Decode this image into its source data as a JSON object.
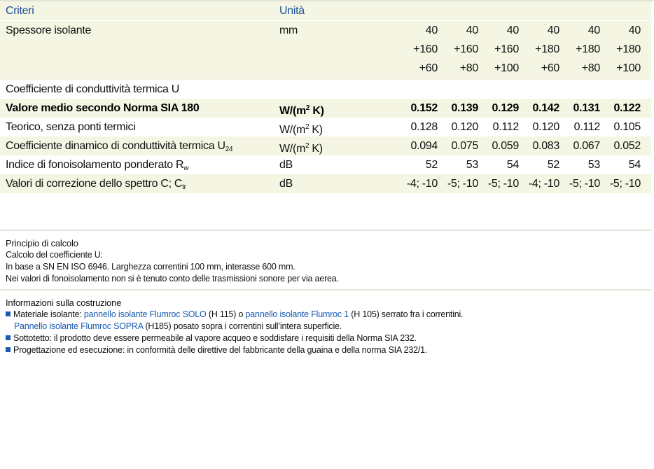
{
  "header": {
    "criteria": "Criteri",
    "unit": "Unità"
  },
  "rows": [
    {
      "label": "Spessore isolante",
      "unit": "mm",
      "values": [
        "40",
        "40",
        "40",
        "40",
        "40",
        "40"
      ]
    },
    {
      "values": [
        "+160",
        "+160",
        "+160",
        "+180",
        "+180",
        "+180"
      ]
    },
    {
      "values": [
        "+60",
        "+80",
        "+100",
        "+60",
        "+80",
        "+100"
      ]
    },
    {
      "label": "Coefficiente di conduttività termica U"
    },
    {
      "label": "Valore medio secondo Norma SIA 180",
      "unit": "W/(m",
      "unit_sup": "2",
      "unit_end": " K)",
      "values": [
        "0.152",
        "0.139",
        "0.129",
        "0.142",
        "0.131",
        "0.122"
      ]
    },
    {
      "label": "Teorico, senza ponti termici",
      "unit": "W/(m",
      "unit_sup": "2",
      "unit_end": " K)",
      "values": [
        "0.128",
        "0.120",
        "0.112",
        "0.120",
        "0.112",
        "0.105"
      ]
    },
    {
      "label": "Coefficiente dinamico di conduttività termica U",
      "label_sub": "24",
      "unit": "W/(m",
      "unit_sup": "2",
      "unit_end": " K)",
      "values": [
        "0.094",
        "0.075",
        "0.059",
        "0.083",
        "0.067",
        "0.052"
      ]
    },
    {
      "label": "Indice di fonoisolamento ponderato R",
      "label_sub": "w",
      "unit": "dB",
      "values": [
        "52",
        "53",
        "54",
        "52",
        "53",
        "54"
      ]
    },
    {
      "label": "Valori di correzione dello spettro C; C",
      "label_sub": "tr",
      "unit": "dB",
      "values": [
        "-4; -10",
        "-5; -10",
        "-5; -10",
        "-4; -10",
        "-5; -10",
        "-5; -10"
      ]
    }
  ],
  "calc": {
    "title": "Principio di calcolo",
    "line1": "Calcolo del coefficiente U:",
    "line2": "In base a SN EN ISO 6946. Larghezza correntini 100 mm, interasse 600 mm.",
    "line3": "Nei valori di fonoisolamento non si è tenuto conto delle trasmissioni sonore per via aerea."
  },
  "construction": {
    "title": "Informazioni sulla costruzione",
    "b1_pre": "Materiale isolante: ",
    "b1_link1": "pannello isolante Flumroc SOLO",
    "b1_mid": " (H 115) o ",
    "b1_link2": "pannello isolante Flumroc 1",
    "b1_post": " (H 105) serrato fra i correntini.",
    "b1_link3": "Pannello isolante Flumroc SOPRA",
    "b1_post2": " (H185) posato sopra i correntini sull’intera superficie.",
    "b2": "Sottotetto: il prodotto deve essere permeabile al vapore acqueo e soddisfare i requisiti della Norma SIA 232.",
    "b3": "Progettazione ed esecuzione: in conformità delle direttive del fabbricante della guaina e della norma SIA 232/1."
  },
  "colors": {
    "accent": "#1a5bb0",
    "band": "#f4f5e3",
    "separator": "#e3e6da"
  }
}
